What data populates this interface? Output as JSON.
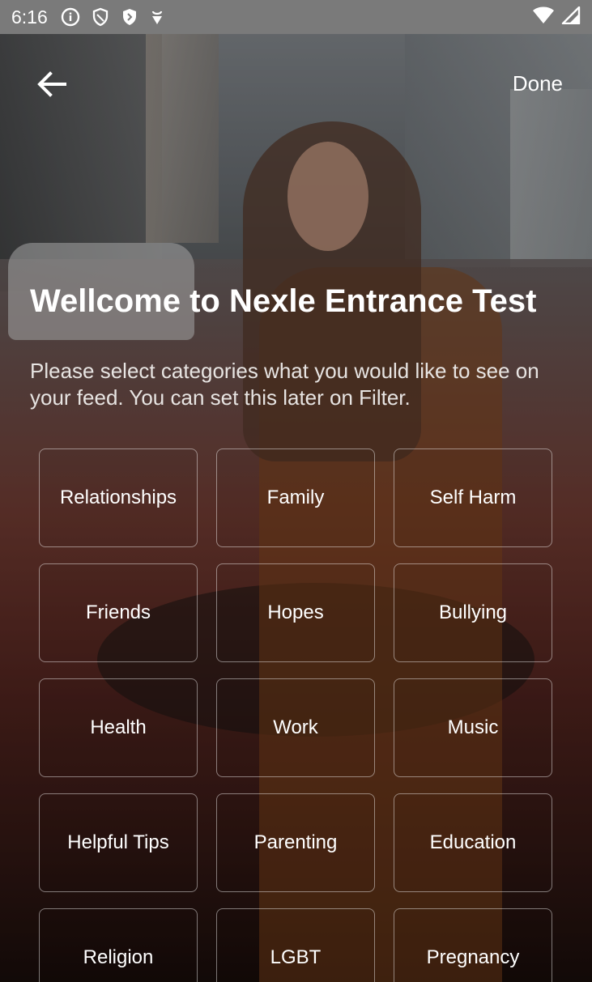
{
  "status_bar": {
    "time": "6:16",
    "left_icons": [
      "info-circle-icon",
      "shield-outline-icon",
      "shield-filled-icon",
      "usb-debug-icon"
    ],
    "right_icons": [
      "wifi-icon",
      "signal-icon"
    ]
  },
  "header": {
    "back_icon": "arrow-left-icon",
    "done_label": "Done"
  },
  "content": {
    "title": "Wellcome to Nexle Entrance Test",
    "subtitle": "Please select categories what you would like to see on your feed. You can set this later on Filter."
  },
  "categories": [
    {
      "label": "Relationships"
    },
    {
      "label": "Family"
    },
    {
      "label": "Self Harm"
    },
    {
      "label": "Friends"
    },
    {
      "label": "Hopes"
    },
    {
      "label": "Bullying"
    },
    {
      "label": "Health"
    },
    {
      "label": "Work"
    },
    {
      "label": "Music"
    },
    {
      "label": "Helpful Tips"
    },
    {
      "label": "Parenting"
    },
    {
      "label": "Education"
    },
    {
      "label": "Religion"
    },
    {
      "label": "LGBT"
    },
    {
      "label": "Pregnancy"
    }
  ],
  "colors": {
    "text": "#ffffff",
    "status_bar_bg": "#7a7a7a",
    "tile_border": "rgba(255,255,255,0.45)"
  }
}
